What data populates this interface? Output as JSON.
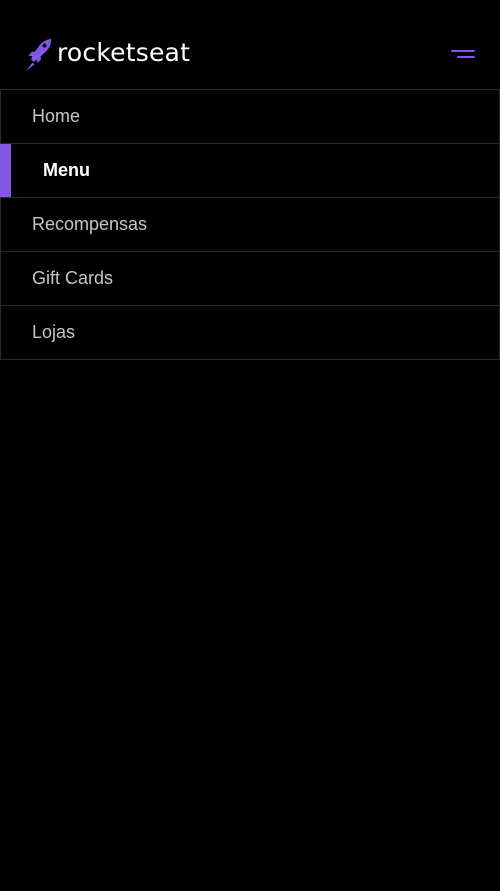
{
  "header": {
    "logo_text": "rocketseat",
    "logo_icon": "rocket-icon",
    "menu_icon": "menu-icon"
  },
  "nav": {
    "items": [
      {
        "label": "Home",
        "active": false
      },
      {
        "label": "Menu",
        "active": true
      },
      {
        "label": "Recompensas",
        "active": false
      },
      {
        "label": "Gift Cards",
        "active": false
      },
      {
        "label": "Lojas",
        "active": false
      }
    ]
  },
  "colors": {
    "background": "#000000",
    "accent": "#8257e5",
    "text": "#c4c4cc",
    "text_active": "#ffffff",
    "border": "#29292e"
  }
}
